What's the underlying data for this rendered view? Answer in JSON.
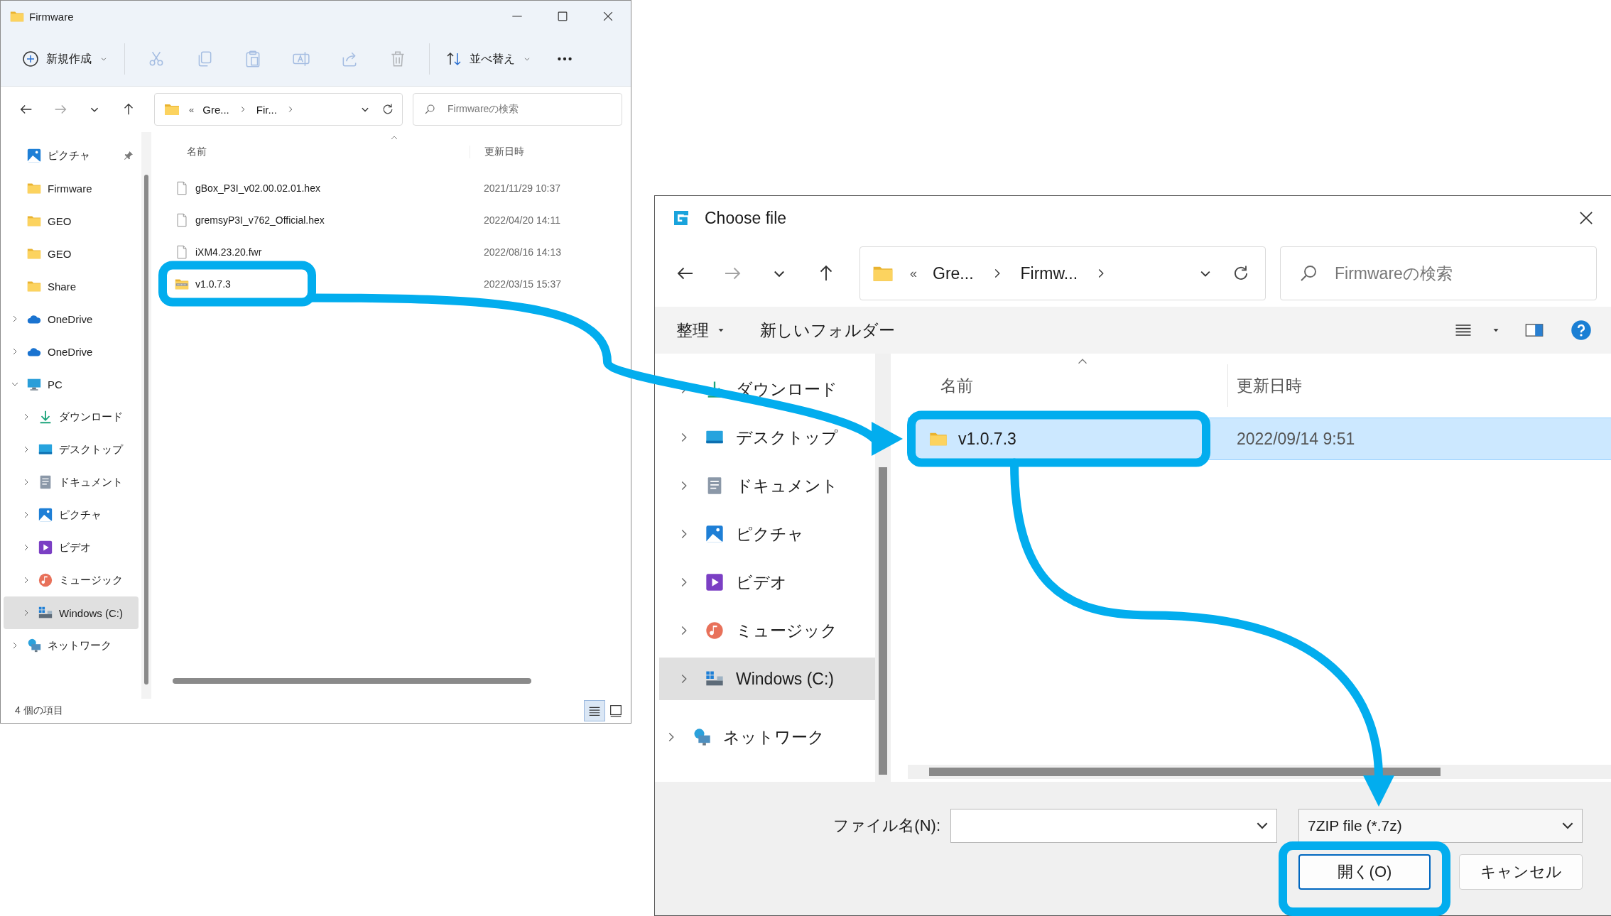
{
  "explorer": {
    "title": "Firmware",
    "toolbar": {
      "new_label": "新規作成",
      "sort_label": "並べ替え"
    },
    "actions": [
      {
        "kind": "cut",
        "disabled": true
      },
      {
        "kind": "copy",
        "disabled": true
      },
      {
        "kind": "paste",
        "disabled": true
      },
      {
        "kind": "rename",
        "disabled": true
      },
      {
        "kind": "share",
        "disabled": true
      },
      {
        "kind": "delete",
        "disabled": true
      }
    ],
    "nav_buttons": [
      {
        "kind": "back",
        "disabled": false
      },
      {
        "kind": "forward",
        "disabled": true
      },
      {
        "kind": "recent",
        "disabled": false
      },
      {
        "kind": "up",
        "disabled": false
      }
    ],
    "address": {
      "overflow": "«",
      "path": [
        "Gre...",
        "Fir..."
      ]
    },
    "search": {
      "placeholder": "Firmwareの検索"
    },
    "nav": [
      {
        "label": "ピクチャ",
        "kind": "picture",
        "expandable": false,
        "expanded": false,
        "selected": false,
        "pinned": true
      },
      {
        "label": "Firmware",
        "kind": "folder",
        "expandable": false,
        "expanded": false,
        "selected": false,
        "pinned": false
      },
      {
        "label": "GEO",
        "kind": "folder",
        "expandable": false,
        "expanded": false,
        "selected": false,
        "pinned": false
      },
      {
        "label": "GEO",
        "kind": "folder",
        "expandable": false,
        "expanded": false,
        "selected": false,
        "pinned": false
      },
      {
        "label": "Share",
        "kind": "folder",
        "expandable": false,
        "expanded": false,
        "selected": false,
        "pinned": false
      },
      {
        "label": "OneDrive",
        "kind": "cloud",
        "expandable": true,
        "expanded": false,
        "selected": false,
        "pinned": false
      },
      {
        "label": "OneDrive",
        "kind": "cloud",
        "expandable": true,
        "expanded": false,
        "selected": false,
        "pinned": false
      },
      {
        "label": "PC",
        "kind": "pc",
        "expandable": true,
        "expanded": true,
        "selected": false,
        "pinned": false,
        "children": [
          {
            "label": "ダウンロード",
            "kind": "download",
            "expandable": true,
            "expanded": false,
            "selected": false,
            "pinned": false
          },
          {
            "label": "デスクトップ",
            "kind": "desktop",
            "expandable": true,
            "expanded": false,
            "selected": false,
            "pinned": false
          },
          {
            "label": "ドキュメント",
            "kind": "document",
            "expandable": true,
            "expanded": false,
            "selected": false,
            "pinned": false
          },
          {
            "label": "ピクチャ",
            "kind": "picture",
            "expandable": true,
            "expanded": false,
            "selected": false,
            "pinned": false
          },
          {
            "label": "ビデオ",
            "kind": "video",
            "expandable": true,
            "expanded": false,
            "selected": false,
            "pinned": false
          },
          {
            "label": "ミュージック",
            "kind": "music",
            "expandable": true,
            "expanded": false,
            "selected": false,
            "pinned": false
          },
          {
            "label": "Windows (C:)",
            "kind": "drive",
            "expandable": true,
            "expanded": false,
            "selected": true,
            "pinned": false
          }
        ]
      },
      {
        "label": "ネットワーク",
        "kind": "network",
        "expandable": true,
        "expanded": false,
        "selected": false,
        "pinned": false
      }
    ],
    "columns": [
      "名前",
      "更新日時"
    ],
    "files": [
      {
        "name": "gBox_P3I_v02.00.02.01.hex",
        "date": "2021/11/29 10:37",
        "kind": "file",
        "selected": false
      },
      {
        "name": "gremsyP3I_v762_Official.hex",
        "date": "2022/04/20 14:11",
        "kind": "file",
        "selected": false
      },
      {
        "name": "iXM4.23.20.fwr",
        "date": "2022/08/16 14:13",
        "kind": "file",
        "selected": false
      },
      {
        "name": "v1.0.7.3",
        "date": "2022/03/15 15:37",
        "kind": "zip",
        "selected": false
      }
    ],
    "status": "4 個の項目",
    "views": [
      {
        "kind": "details",
        "selected": true
      },
      {
        "kind": "tiles",
        "selected": false
      }
    ]
  },
  "dialog": {
    "title": "Choose file",
    "nav_buttons": [
      {
        "kind": "back",
        "disabled": false
      },
      {
        "kind": "forward",
        "disabled": true
      },
      {
        "kind": "recent",
        "disabled": false
      },
      {
        "kind": "up",
        "disabled": false
      }
    ],
    "address": {
      "overflow": "«",
      "path": [
        "Gre...",
        "Firmw..."
      ]
    },
    "search": {
      "placeholder": "Firmwareの検索"
    },
    "commands": {
      "organize": "整理",
      "new_folder": "新しいフォルダー"
    },
    "nav": [
      {
        "label": "ダウンロード",
        "kind": "download",
        "expandable": true,
        "expanded": false,
        "selected": false
      },
      {
        "label": "デスクトップ",
        "kind": "desktop",
        "expandable": true,
        "expanded": false,
        "selected": false
      },
      {
        "label": "ドキュメント",
        "kind": "document",
        "expandable": true,
        "expanded": false,
        "selected": false
      },
      {
        "label": "ピクチャ",
        "kind": "picture",
        "expandable": true,
        "expanded": false,
        "selected": false
      },
      {
        "label": "ビデオ",
        "kind": "video",
        "expandable": true,
        "expanded": false,
        "selected": false
      },
      {
        "label": "ミュージック",
        "kind": "music",
        "expandable": true,
        "expanded": false,
        "selected": false
      },
      {
        "label": "Windows (C:)",
        "kind": "drive",
        "expandable": true,
        "expanded": false,
        "selected": true
      },
      {
        "label": "ネットワーク",
        "kind": "network",
        "expandable": true,
        "expanded": false,
        "selected": false
      }
    ],
    "columns": [
      "名前",
      "更新日時"
    ],
    "files": [
      {
        "name": "v1.0.7.3",
        "date": "2022/09/14 9:51",
        "kind": "folder",
        "selected": true
      }
    ],
    "filename_label": "ファイル名(N):",
    "filter": "7ZIP file (*.7z)",
    "buttons": [
      {
        "label": "開く(O)",
        "kind": "default"
      },
      {
        "label": "キャンセル",
        "kind": "normal"
      }
    ]
  }
}
